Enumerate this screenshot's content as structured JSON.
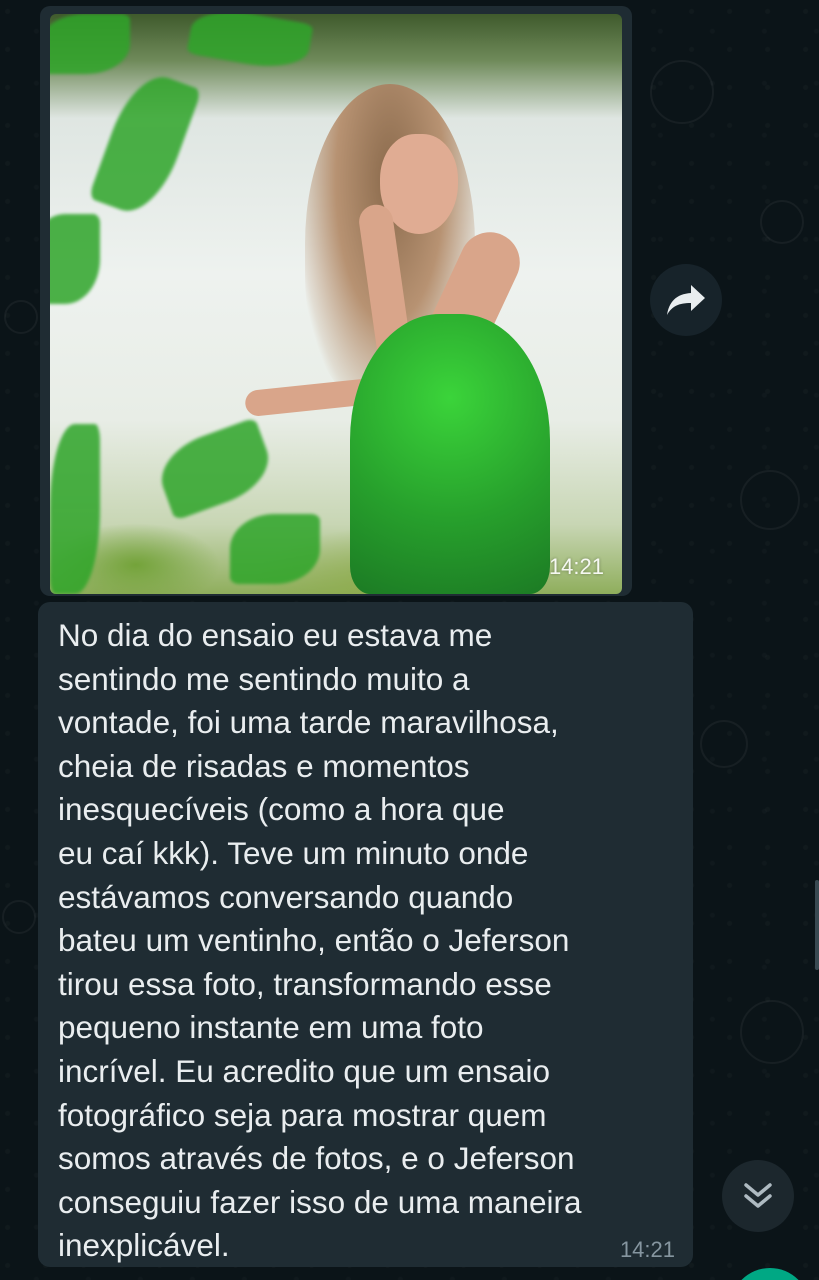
{
  "image_message": {
    "time": "14:21",
    "alt": "photo"
  },
  "forward_button": {
    "icon": "forward-arrow-icon"
  },
  "text_message": {
    "lines": [
      "No dia do ensaio eu estava me",
      "sentindo me sentindo muito a",
      "vontade, foi uma tarde maravilhosa,",
      "cheia de risadas e momentos",
      "inesquecíveis (como a hora que",
      "eu caí kkk). Teve um minuto onde",
      "estávamos conversando quando",
      "bateu um ventinho, então o Jeferson",
      "tirou essa foto, transformando esse",
      "pequeno instante em uma foto",
      "incrível. Eu acredito que um ensaio",
      "fotográfico seja para mostrar quem",
      "somos através de fotos, e o Jeferson",
      "conseguiu fazer isso de uma maneira",
      "inexplicável."
    ],
    "time": "14:21"
  },
  "scroll_button": {
    "icon": "double-chevron-down-icon"
  },
  "colors": {
    "background": "#0b1418",
    "bubble": "#1f2c33",
    "text": "#e9edef",
    "meta": "#8696a0",
    "accent": "#00a884"
  }
}
